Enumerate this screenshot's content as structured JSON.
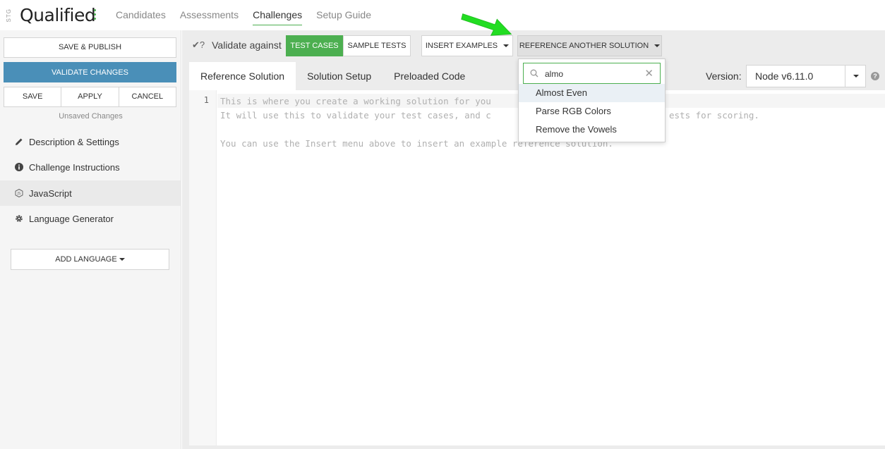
{
  "header": {
    "env_label": "STG",
    "logo": "Qualified",
    "nav": [
      "Candidates",
      "Assessments",
      "Challenges",
      "Setup Guide"
    ],
    "active_nav": "Challenges"
  },
  "sidebar": {
    "save_publish": "SAVE & PUBLISH",
    "validate_changes": "VALIDATE CHANGES",
    "save": "SAVE",
    "apply": "APPLY",
    "cancel": "CANCEL",
    "unsaved": "Unsaved Changes",
    "items": [
      {
        "label": "Description & Settings",
        "icon": "pencil-icon"
      },
      {
        "label": "Challenge Instructions",
        "icon": "info-icon"
      },
      {
        "label": "JavaScript",
        "icon": "js-icon"
      },
      {
        "label": "Language Generator",
        "icon": "gear-icon"
      }
    ],
    "add_language": "ADD LANGUAGE"
  },
  "toolbar": {
    "validate_against": "Validate against",
    "test_cases": "TEST CASES",
    "sample_tests": "SAMPLE TESTS",
    "insert_examples": "INSERT EXAMPLES",
    "reference_another": "REFERENCE ANOTHER SOLUTION"
  },
  "tabs": [
    "Reference Solution",
    "Solution Setup",
    "Preloaded Code"
  ],
  "version": {
    "label": "Version:",
    "value": "Node v6.11.0"
  },
  "editor": {
    "line_number": "1",
    "lines": [
      "This is where you create a working solution for you",
      "It will use this to validate your test cases, and c",
      "You can use the Insert menu above to insert an example reference solution."
    ],
    "line2_tail": "ests for scoring."
  },
  "dropdown": {
    "search_value": "almo",
    "options": [
      "Almost Even",
      "Parse RGB Colors",
      "Remove the Vowels"
    ]
  },
  "colors": {
    "accent_green": "#4caf50",
    "validate_blue": "#4a8fb8",
    "arrow_green": "#22dd22"
  }
}
